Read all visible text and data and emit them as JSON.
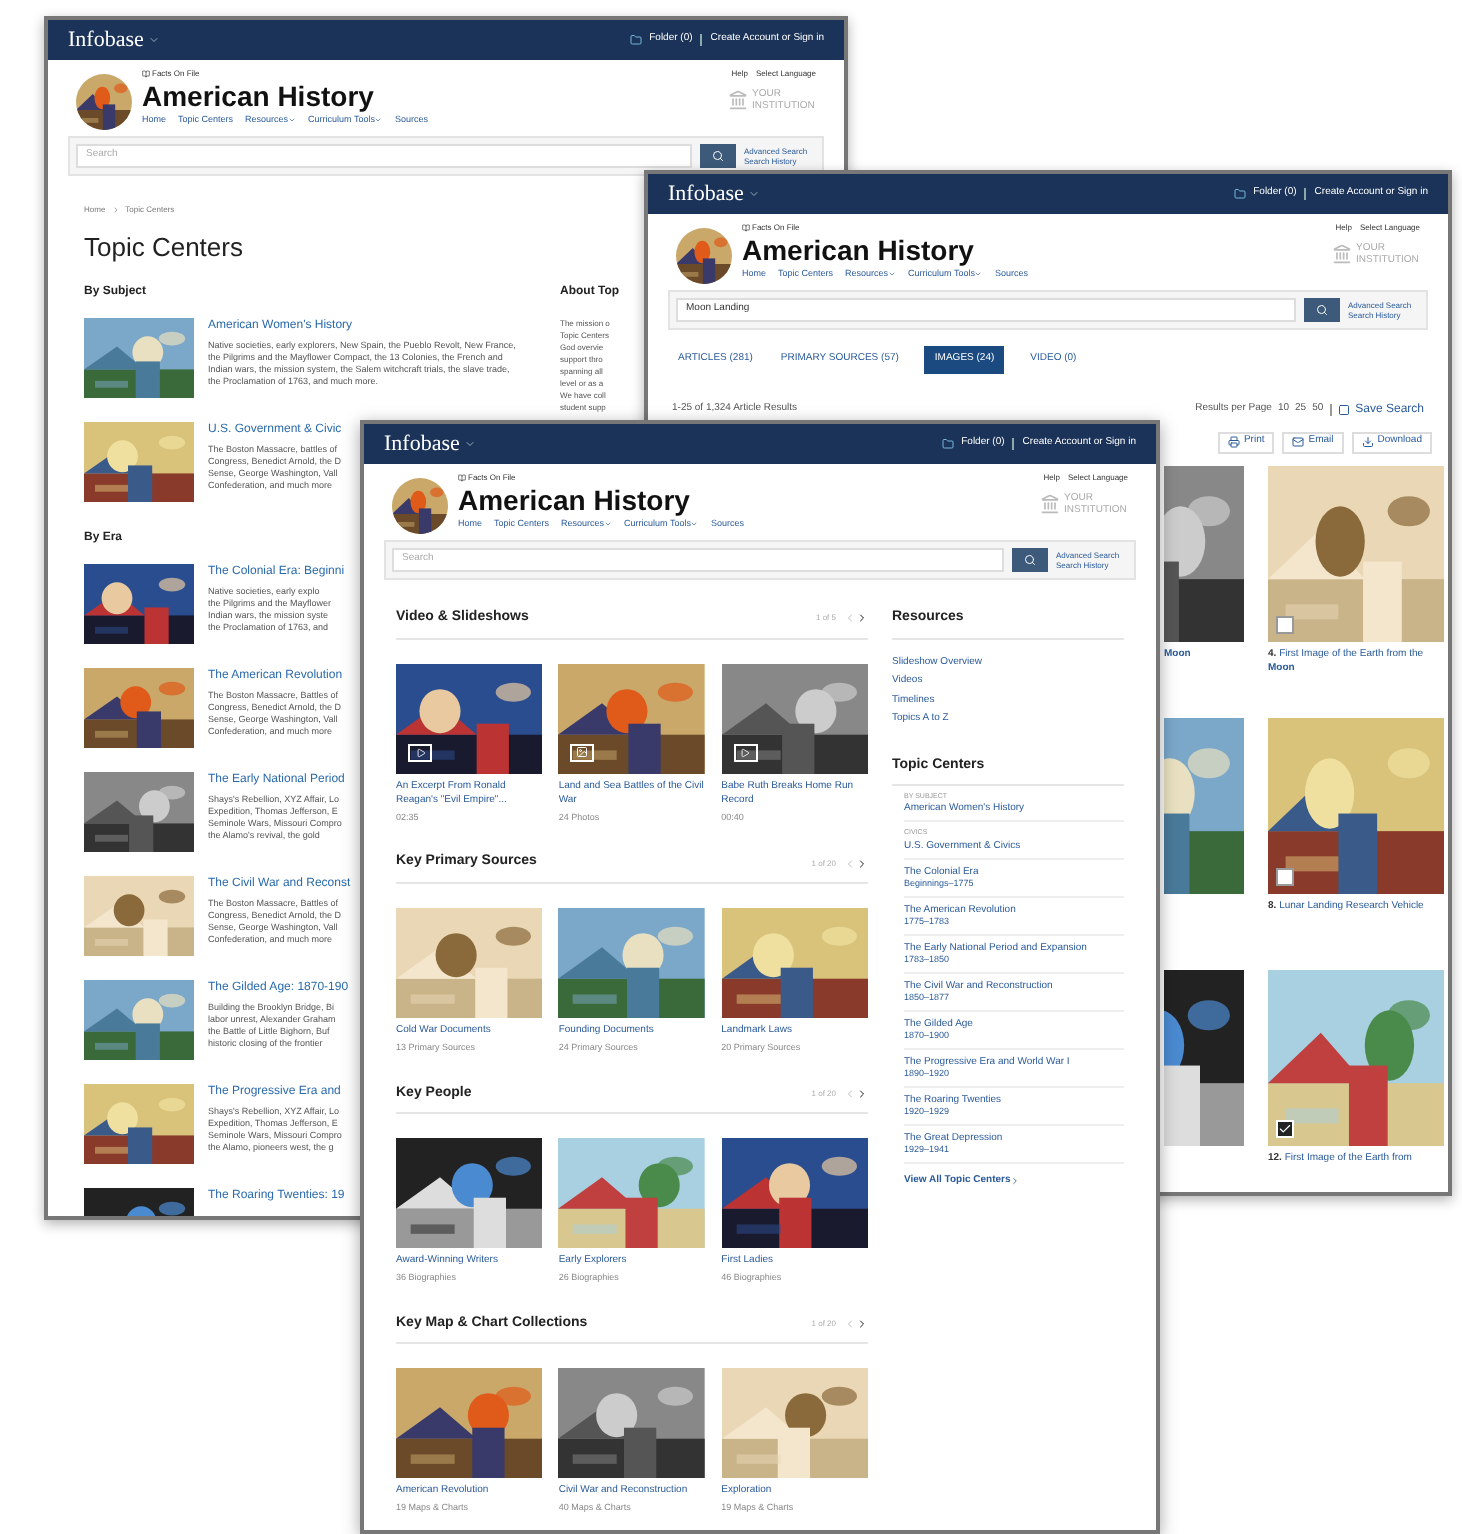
{
  "topic_centers_page": {
    "header": {
      "brand": "Infobase",
      "folder": "Folder (0)",
      "account": "Create Account or Sign in"
    },
    "publisher": "Facts On File",
    "title": "American History",
    "nav": [
      {
        "label": "Home",
        "dropdown": false
      },
      {
        "label": "Topic Centers",
        "dropdown": false
      },
      {
        "label": "Resources",
        "dropdown": true
      },
      {
        "label": "Curriculum Tools",
        "dropdown": true
      },
      {
        "label": "Sources",
        "dropdown": false
      }
    ],
    "help": "Help",
    "language": "Select Language",
    "institution": "YOUR INSTITUTION",
    "search": {
      "placeholder": "Search"
    },
    "search_links": [
      "Advanced Search",
      "Search History"
    ],
    "breadcrumb": [
      "Home",
      "Topic Centers"
    ],
    "heading": "Topic Centers",
    "subject_heading": "By Subject",
    "about_heading": "About Top",
    "about_lines": [
      "The mission o",
      "Topic Centers",
      "God overvie",
      "support thro",
      "spanning all",
      "level or as a",
      "We have coll",
      "student supp"
    ],
    "subject_items": [
      {
        "title": "American Women's History",
        "lines": [
          "Native societies, early explorers, New Spain, the Pueblo Revolt, New France,",
          "the Pilgrims and the Mayflower Compact, the 13 Colonies, the French and",
          "Indian wars, the mission system, the Salem witchcraft trials, the slave trade,",
          "the Proclamation of 1763, and much more."
        ]
      },
      {
        "title": "U.S. Government & Civic",
        "lines": [
          "The Boston Massacre, battles of",
          "Congress, Benedict Arnold, the D",
          "Sense, George Washington, Vall",
          "Confederation, and much more"
        ]
      }
    ],
    "era_heading": "By Era",
    "era_items": [
      {
        "title": "The Colonial Era: Beginni",
        "lines": [
          "Native societies, early explo",
          "the Pilgrims and the Mayflower",
          "Indian wars, the mission syste",
          "the Proclamation of 1763, and"
        ]
      },
      {
        "title": "The American Revolution",
        "lines": [
          "The Boston Massacre, Battles of",
          "Congress, Benedict Arnold, the D",
          "Sense, George Washington, Vall",
          "Confederation, and much more"
        ]
      },
      {
        "title": "The Early National Period",
        "lines": [
          "Shays's Rebellion, XYZ Affair, Lo",
          "Expedition, Thomas Jefferson, E",
          "Seminole Wars, Missouri Compro",
          "the Alamo's revival, the gold"
        ]
      },
      {
        "title": "The Civil War and Reconst",
        "lines": [
          "The Boston Massacre, Battles of",
          "Congress, Benedict Arnold, the D",
          "Sense, George Washington, Vall",
          "Confederation, and much more"
        ]
      },
      {
        "title": "The Gilded Age: 1870-190",
        "lines": [
          "Building the Brooklyn Bridge, Bi",
          "labor unrest, Alexander Graham",
          "the Battle of Little Bighorn, Buf",
          "historic closing of the frontier"
        ]
      },
      {
        "title": "The Progressive Era and",
        "lines": [
          "Shays's Rebellion, XYZ Affair, Lo",
          "Expedition, Thomas Jefferson, E",
          "Seminole Wars, Missouri Compro",
          "the Alamo, pioneers west, the g"
        ]
      },
      {
        "title": "The Roaring Twenties: 19"
      }
    ]
  },
  "search_results_page": {
    "header": {
      "brand": "Infobase",
      "folder": "Folder (0)",
      "account": "Create Account or Sign in"
    },
    "publisher": "Facts On File",
    "title": "American History",
    "nav": [
      {
        "label": "Home",
        "dropdown": false
      },
      {
        "label": "Topic Centers",
        "dropdown": false
      },
      {
        "label": "Resources",
        "dropdown": true
      },
      {
        "label": "Curriculum Tools",
        "dropdown": true
      },
      {
        "label": "Sources",
        "dropdown": false
      }
    ],
    "help": "Help",
    "language": "Select Language",
    "institution": "YOUR INSTITUTION",
    "search": {
      "value": "Moon Landing"
    },
    "search_links": [
      "Advanced Search",
      "Search History"
    ],
    "tabs": [
      {
        "label": "ARTICLES (281)",
        "selected": false
      },
      {
        "label": "PRIMARY SOURCES (57)",
        "selected": false
      },
      {
        "label": "IMAGES (24)",
        "selected": true
      },
      {
        "label": "VIDEO (0)",
        "selected": false
      }
    ],
    "result_count": "1-25 of 1,324 Article Results",
    "per_page_label": "Results per Page",
    "per_page": [
      "10",
      "25",
      "50"
    ],
    "save_search": "Save Search",
    "tools": [
      {
        "label": "Print",
        "kind": "print"
      },
      {
        "label": "Email",
        "kind": "email"
      },
      {
        "label": "Download",
        "kind": "download"
      }
    ],
    "images": [
      {
        "caption": "**Moon**",
        "partial": true
      },
      {
        "number": "4.",
        "caption": "First Image of the Earth from the **Moon**",
        "checked": false,
        "partial": false
      },
      {
        "partial": true
      },
      {
        "number": "8.",
        "caption": "Lunar Landing Research Vehicle",
        "checked": false,
        "partial": false
      },
      {
        "partial": true
      },
      {
        "number": "12.",
        "caption": "First Image of the Earth from",
        "checked": true,
        "partial": false
      }
    ]
  },
  "home_page": {
    "header": {
      "brand": "Infobase",
      "folder": "Folder (0)",
      "account": "Create Account or Sign in"
    },
    "publisher": "Facts On File",
    "title": "American History",
    "nav": [
      {
        "label": "Home",
        "dropdown": false
      },
      {
        "label": "Topic Centers",
        "dropdown": false
      },
      {
        "label": "Resources",
        "dropdown": true
      },
      {
        "label": "Curriculum Tools",
        "dropdown": true
      },
      {
        "label": "Sources",
        "dropdown": false
      }
    ],
    "help": "Help",
    "language": "Select Language",
    "institution": "YOUR INSTITUTION",
    "search": {
      "placeholder": "Search"
    },
    "search_links": [
      "Advanced Search",
      "Search History"
    ],
    "sections": [
      {
        "heading": "Video & Slideshows",
        "pager": "1 of 5",
        "cards": [
          {
            "title": "An Excerpt From Ronald Reagan's \"Evil Empire\"...",
            "meta": "02:35",
            "kind": "video"
          },
          {
            "title": "Land and Sea Battles of the Civil War",
            "meta": "24 Photos",
            "kind": "slideshow"
          },
          {
            "title": "Babe Ruth Breaks Home Run Record",
            "meta": "00:40",
            "kind": "video"
          }
        ]
      },
      {
        "heading": "Key Primary Sources",
        "pager": "1 of 20",
        "cards": [
          {
            "title": "Cold War Documents",
            "meta": "13 Primary Sources"
          },
          {
            "title": "Founding Documents",
            "meta": "24 Primary Sources"
          },
          {
            "title": "Landmark Laws",
            "meta": "20 Primary Sources"
          }
        ]
      },
      {
        "heading": "Key People",
        "pager": "1 of 20",
        "cards": [
          {
            "title": "Award-Winning Writers",
            "meta": "36 Biographies"
          },
          {
            "title": "Early Explorers",
            "meta": "26 Biographies"
          },
          {
            "title": "First Ladies",
            "meta": "46 Biographies"
          }
        ]
      },
      {
        "heading": "Key Map & Chart Collections",
        "pager": "1 of 20",
        "cards": [
          {
            "title": "American Revolution",
            "meta": "19 Maps & Charts"
          },
          {
            "title": "Civil War and Reconstruction",
            "meta": "40 Maps & Charts"
          },
          {
            "title": "Exploration",
            "meta": "19 Maps & Charts"
          }
        ]
      }
    ],
    "resources_heading": "Resources",
    "resources": [
      "Slideshow Overview",
      "Videos",
      "Timelines",
      "Topics A to Z"
    ],
    "topic_centers_heading": "Topic Centers",
    "topic_centers": [
      {
        "label": "BY SUBJECT",
        "title": "American Women's History"
      },
      {
        "label": "CIVICS",
        "title": "U.S. Government & Civics"
      },
      {
        "title": "The Colonial Era",
        "dates": "Beginnings–1775"
      },
      {
        "title": "The American Revolution",
        "dates": "1775–1783"
      },
      {
        "title": "The Early National Period and Expansion",
        "dates": "1783–1850"
      },
      {
        "title": "The Civil War and Reconstruction",
        "dates": "1850–1877"
      },
      {
        "title": "The Gilded Age",
        "dates": "1870–1900"
      },
      {
        "title": "The Progressive Era and World War I",
        "dates": "1890–1920"
      },
      {
        "title": "The Roaring Twenties",
        "dates": "1920–1929"
      },
      {
        "title": "The Great Depression",
        "dates": "1929–1941"
      }
    ],
    "view_all": "View All Topic Centers"
  }
}
